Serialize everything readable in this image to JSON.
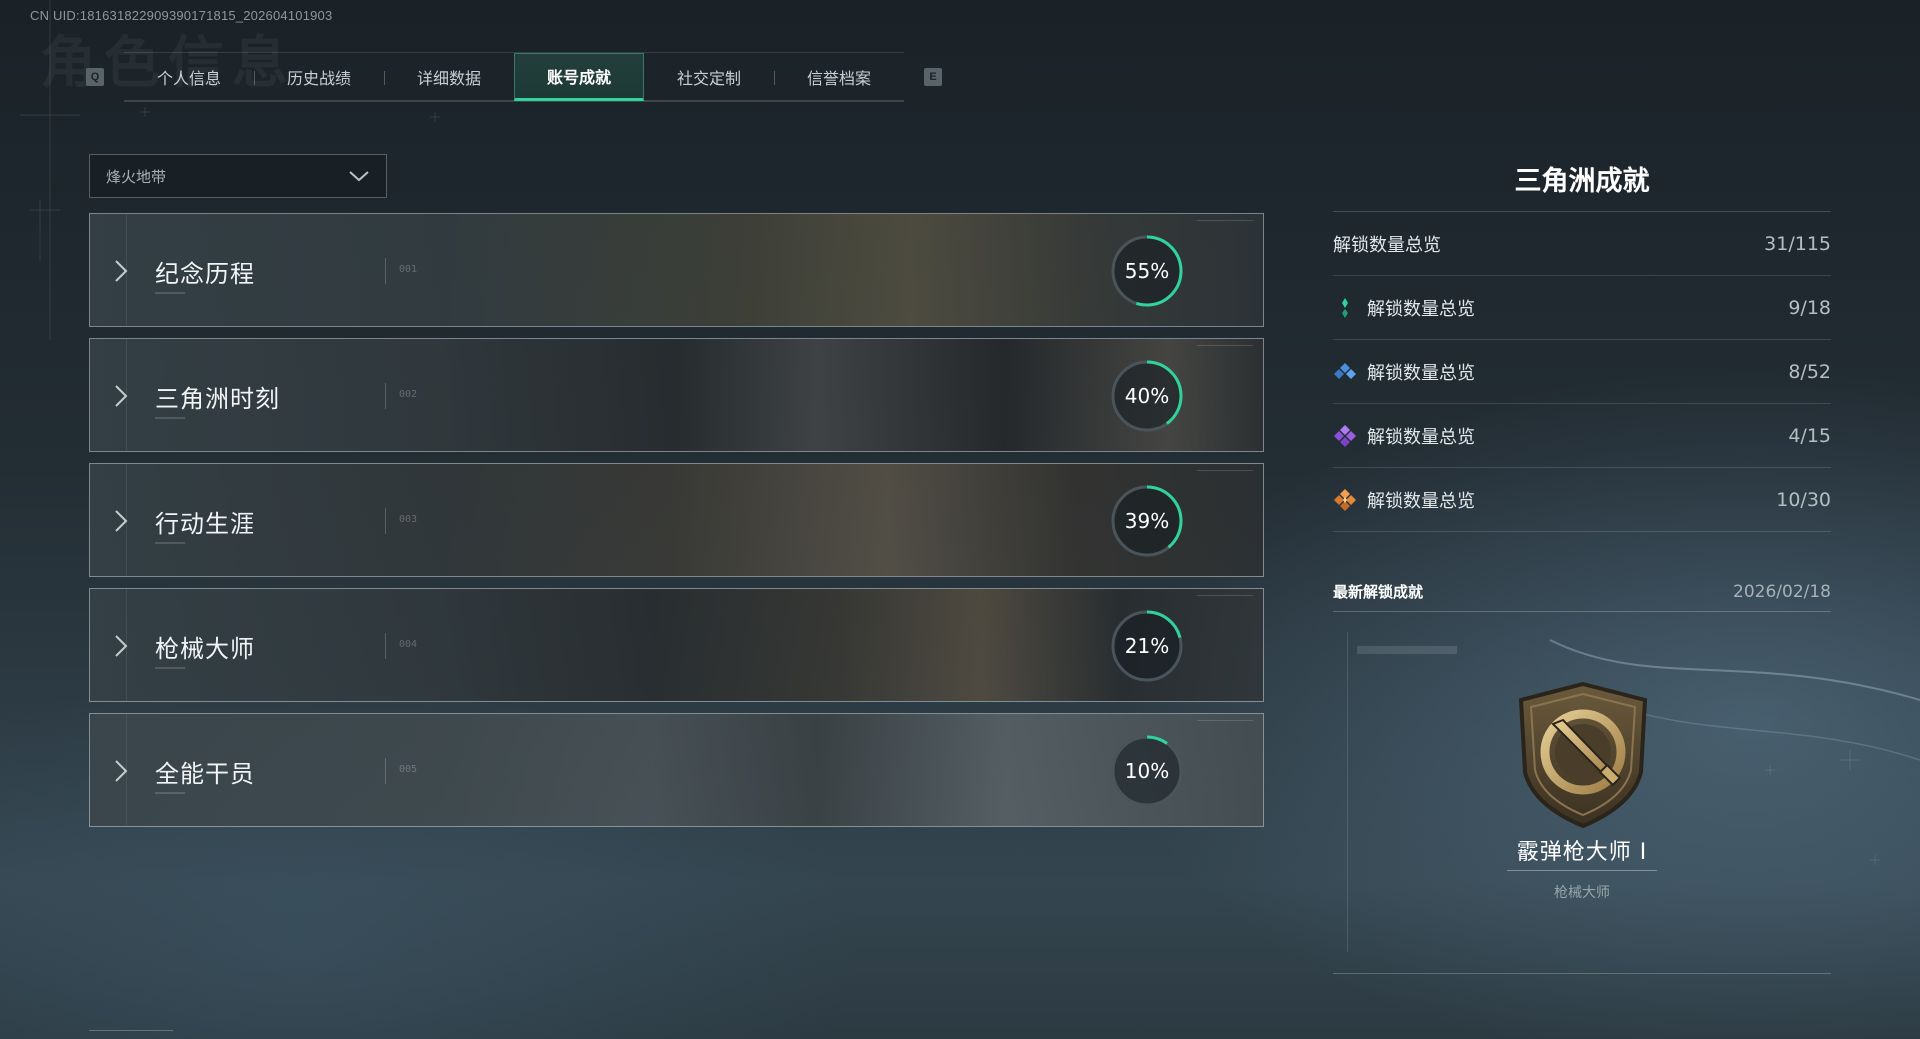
{
  "uid": "CN UID:181631822909390171815_202604101903",
  "background_title": "角色信息",
  "tabs": {
    "left_key": "Q",
    "right_key": "E",
    "items": [
      "个人信息",
      "历史战绩",
      "详细数据",
      "账号成就",
      "社交定制",
      "信誉档案"
    ],
    "active_index": 3
  },
  "mode_dropdown": {
    "selected": "烽火地带"
  },
  "categories": [
    {
      "name": "纪念历程",
      "index": "001",
      "percent_label": "55%",
      "progress": 0.55
    },
    {
      "name": "三角洲时刻",
      "index": "002",
      "percent_label": "40%",
      "progress": 0.4
    },
    {
      "name": "行动生涯",
      "index": "003",
      "percent_label": "39%",
      "progress": 0.39
    },
    {
      "name": "枪械大师",
      "index": "004",
      "percent_label": "21%",
      "progress": 0.21
    },
    {
      "name": "全能干员",
      "index": "005",
      "percent_label": "10%",
      "progress": 0.1
    }
  ],
  "panel": {
    "title": "三角洲成就",
    "summary": {
      "label": "解锁数量总览",
      "value": "31/115"
    },
    "tiers": [
      {
        "label": "解锁数量总览",
        "value": "9/18",
        "icon": "green-gem-icon",
        "color": "#2fd39b"
      },
      {
        "label": "解锁数量总览",
        "value": "8/52",
        "icon": "blue-gem-icon",
        "color": "#4a8fe0"
      },
      {
        "label": "解锁数量总览",
        "value": "4/15",
        "icon": "purple-gem-icon",
        "color": "#9a5fe0"
      },
      {
        "label": "解锁数量总览",
        "value": "10/30",
        "icon": "orange-gem-icon",
        "color": "#e08a3a"
      }
    ],
    "latest": {
      "label": "最新解锁成就",
      "date": "2026/02/18",
      "achievement_name": "霰弹枪大师 I",
      "achievement_category": "枪械大师",
      "badge_icon": "shotgun-badge-icon"
    }
  },
  "colors": {
    "accent": "#2fd39b",
    "ring_track": "#4a555b"
  }
}
